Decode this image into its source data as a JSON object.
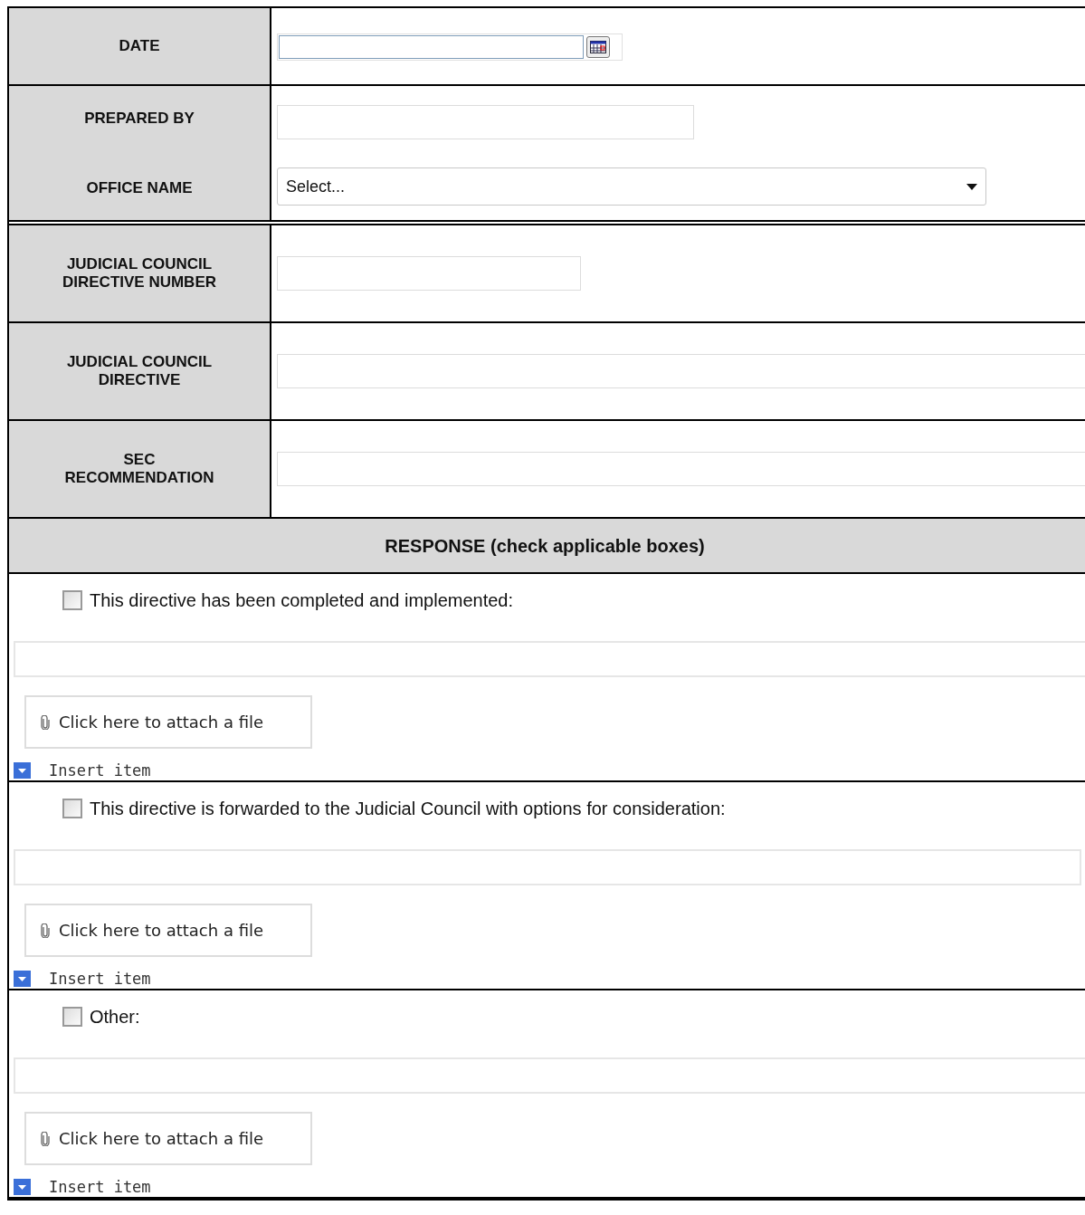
{
  "fields": [
    {
      "kind": "date",
      "labels": [
        "DATE"
      ]
    },
    {
      "kind": "text_select",
      "labels": [
        "PREPARED BY",
        "OFFICE NAME"
      ],
      "select": {
        "value": "Select..."
      }
    },
    {
      "kind": "short",
      "labels": [
        "JUDICIAL COUNCIL",
        "DIRECTIVE NUMBER"
      ]
    },
    {
      "kind": "wide",
      "labels": [
        "JUDICIAL COUNCIL",
        "DIRECTIVE"
      ]
    },
    {
      "kind": "wide",
      "labels": [
        "SEC",
        "RECOMMENDATION"
      ]
    }
  ],
  "response": {
    "title": "RESPONSE (check applicable boxes)",
    "sections": [
      {
        "label": "This directive has been completed and implemented:",
        "checked": false,
        "attach": "Click here to attach a file",
        "insert": "Insert item"
      },
      {
        "label": "This directive is forwarded to the Judicial Council with options for consideration:",
        "checked": false,
        "attach": "Click here to attach a file",
        "insert": "Insert item"
      },
      {
        "label": "Other:",
        "checked": false,
        "attach": "Click here to attach a file",
        "insert": "Insert item"
      }
    ]
  }
}
